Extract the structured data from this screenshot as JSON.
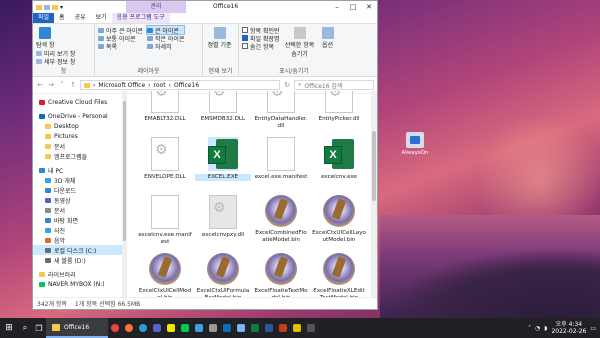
{
  "window": {
    "title": "Office16",
    "context_tab_header": "관리",
    "tabs": [
      "파일",
      "홈",
      "공유",
      "보기",
      "응용 프로그램 도구"
    ]
  },
  "ribbon": {
    "groups": [
      {
        "label": "창",
        "items": [
          "탐색 창",
          "미리 보기 창",
          "세부 정보 창"
        ]
      },
      {
        "label": "레이아웃",
        "items": [
          "아주 큰 아이콘",
          "큰 아이콘",
          "보통 아이콘",
          "작은 아이콘",
          "목록",
          "자세히"
        ]
      },
      {
        "label": "현재 보기",
        "items": [
          "정렬 기준"
        ]
      },
      {
        "label": "표시/숨기기",
        "items": [
          "항목 확인란",
          "파일 확장명",
          "숨긴 항목",
          "선택한 항목 숨기기",
          "옵션"
        ]
      }
    ]
  },
  "address": {
    "path": [
      "Microsoft Office",
      "root",
      "Office16"
    ],
    "search_placeholder": "Office16 검색"
  },
  "nav_items": [
    {
      "label": "Creative Cloud Files",
      "icon": "cloud-icon",
      "color": "#da1f26"
    },
    {
      "label": "OneDrive - Personal",
      "icon": "onedrive-icon",
      "color": "#0f6cbd"
    },
    {
      "label": "Desktop",
      "icon": "folder-icon",
      "color": "#f3c94e"
    },
    {
      "label": "Pictures",
      "icon": "folder-icon",
      "color": "#f3c94e"
    },
    {
      "label": "문서",
      "icon": "folder-icon",
      "color": "#f3c94e"
    },
    {
      "label": "엠프로그램들",
      "icon": "folder-icon",
      "color": "#f3c94e"
    },
    {
      "label": "내 PC",
      "icon": "pc-icon",
      "color": "#2b88d8"
    },
    {
      "label": "3D 개체",
      "icon": "3d-icon",
      "color": "#3aa0e0"
    },
    {
      "label": "다운로드",
      "icon": "download-icon",
      "color": "#2b88d8"
    },
    {
      "label": "동영상",
      "icon": "video-icon",
      "color": "#5b5fc7"
    },
    {
      "label": "문서",
      "icon": "document-icon",
      "color": "#8a8a8a"
    },
    {
      "label": "바탕 화면",
      "icon": "desktop-icon",
      "color": "#2b88d8"
    },
    {
      "label": "사진",
      "icon": "photo-icon",
      "color": "#3aa0e0"
    },
    {
      "label": "음악",
      "icon": "music-icon",
      "color": "#e06a2b"
    },
    {
      "label": "로컬 디스크 (C:)",
      "icon": "drive-icon",
      "color": "#6b6b6b"
    },
    {
      "label": "새 볼륨 (D:)",
      "icon": "drive-icon",
      "color": "#6b6b6b"
    },
    {
      "label": "라이브러리",
      "icon": "library-icon",
      "color": "#f3c94e"
    },
    {
      "label": "NAVER MYBOX (N:)",
      "icon": "drive-icon",
      "color": "#03c75a"
    }
  ],
  "files": [
    {
      "name": "EMABLT32.DLL",
      "type": "gear"
    },
    {
      "name": "EMSMDB32.DLL",
      "type": "gear"
    },
    {
      "name": "EntityDataHandler.dll",
      "type": "gear"
    },
    {
      "name": "EntityPicker.dll",
      "type": "gear"
    },
    {
      "name": "ENVELOPE.DLL",
      "type": "gear"
    },
    {
      "name": "EXCEL.EXE",
      "type": "excel",
      "selected": true
    },
    {
      "name": "excel.exe.manifest",
      "type": "doc"
    },
    {
      "name": "excelcnv.exe",
      "type": "excel"
    },
    {
      "name": "excelcnv.exe.manifest",
      "type": "doc"
    },
    {
      "name": "excelcnvpxy.dll",
      "type": "gear"
    },
    {
      "name": "ExcelCombinedFloatieModel.bin",
      "type": "bin"
    },
    {
      "name": "ExcelCtxUICellLayoutModel.bin",
      "type": "bin"
    },
    {
      "name": "ExcelCtxUICellModel.bin",
      "type": "bin"
    },
    {
      "name": "ExcelCtxUIFormulaBarModel.bin",
      "type": "bin"
    },
    {
      "name": "ExcelFloatieTextModel.bin",
      "type": "bin"
    },
    {
      "name": "ExcelFloatieXLEditTextModel.bin",
      "type": "bin"
    }
  ],
  "status": {
    "count": "342개 항목",
    "selection": "1개 항목 선택함 66.5MB"
  },
  "desktop": {
    "icon_label": "AlwaysOn"
  },
  "taskbar": {
    "active_app": "Office16",
    "time": "오후 4:34",
    "date": "2022-02-26"
  }
}
